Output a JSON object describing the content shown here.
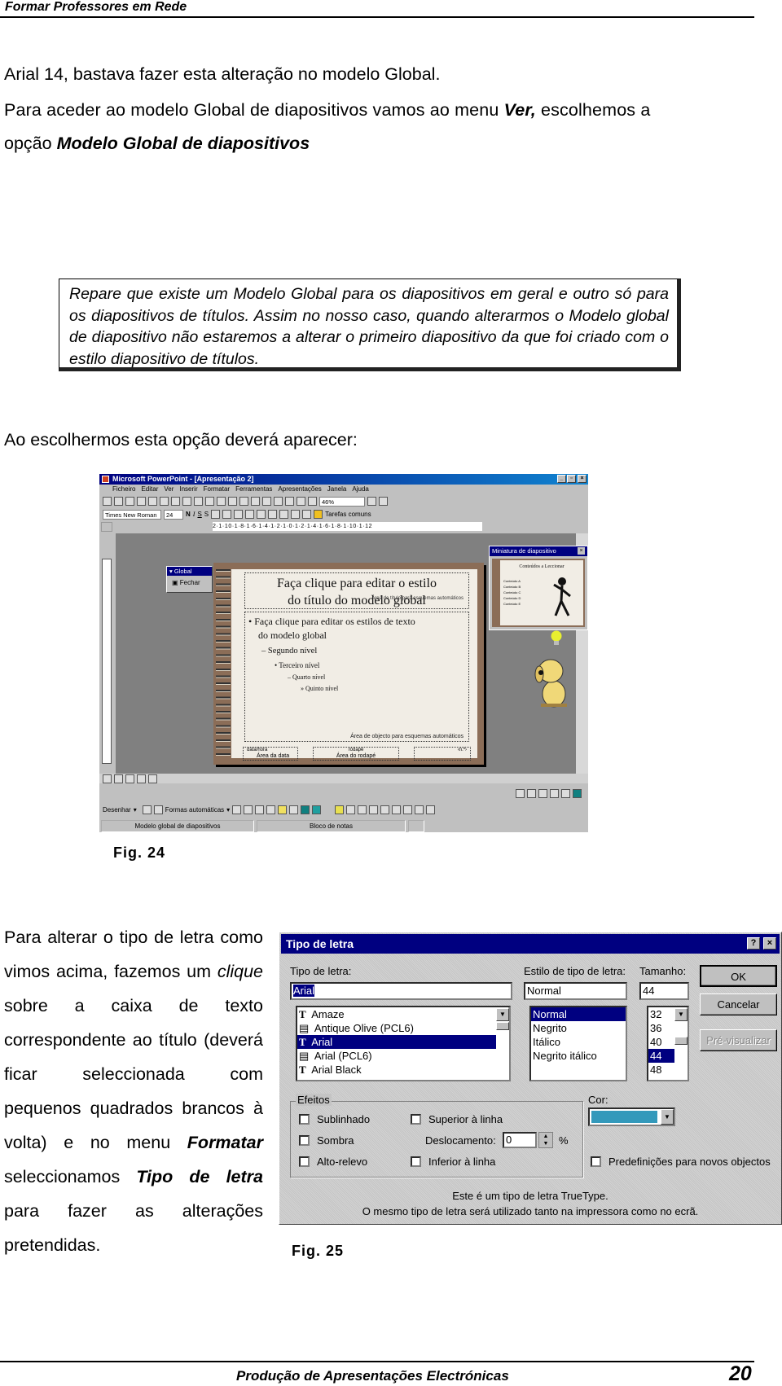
{
  "header": {
    "title": "Formar  Professores em Rede"
  },
  "intro": {
    "line1": "Arial 14, bastava fazer esta alteração no modelo Global.",
    "line2a": "Para aceder ao modelo Global de diapositivos vamos ao menu ",
    "line2b": "Ver,",
    "line2c": " escolhemos a",
    "line3a": "opção ",
    "line3b": "Modelo Global de diapositivos"
  },
  "note": "Repare que existe um Modelo Global para os diapositivos em geral e outro só para os diapositivos de títulos. Assim no nosso caso, quando alterarmos o Modelo global de diapositivo não estaremos a alterar o primeiro diapositivo da que foi criado com o estilo diapositivo de títulos.",
  "lead": "Ao escolhermos esta opção deverá aparecer:",
  "fig24": "Fig. 24",
  "fig25": "Fig. 25",
  "paragraph": {
    "a": "Para alterar o tipo de letra como vimos acima, fazemos um ",
    "b": "clique",
    "c": " sobre a caixa de texto correspondente ao título (deverá ficar seleccionada com pequenos quadrados brancos à volta) e no menu ",
    "d": "Formatar",
    "e": " seleccionamos ",
    "f": "Tipo de letra",
    "g": " para fazer as alterações pretendidas."
  },
  "powerpoint": {
    "title": "Microsoft PowerPoint - [Apresentação 2]",
    "menu": [
      "Ficheiro",
      "Editar",
      "Ver",
      "Inserir",
      "Formatar",
      "Ferramentas",
      "Apresentações",
      "Janela",
      "Ajuda"
    ],
    "zoom": "46%",
    "font": "Times New Roman",
    "size": "24",
    "bold": "N",
    "italic": "I",
    "underline": "S",
    "shadow": "S",
    "tasks": "Tarefas comuns",
    "ruler": "2·1·10·1·8·1·6·1·4·1·2·1·0·1·2·1·4·1·6·1·8·1·10·1·12",
    "global_toolbar": {
      "title": "Global",
      "close": "Fechar"
    },
    "slide": {
      "title": [
        "Faça clique para editar o estilo",
        "do título do modelo global"
      ],
      "title_overlay": "Área de título para esquemas automáticos",
      "levels": [
        "Faça clique para editar os estilos de texto",
        "do modelo global",
        "Segundo nível",
        "Terceiro nível",
        "Quarto nível",
        "Quinto nível"
      ],
      "bullets": [
        "•",
        "–",
        "•",
        "–",
        "»"
      ],
      "object_area": "Área de objecto para esquemas automáticos",
      "date_tag": "data/hora",
      "date_area": "Área da data",
      "footer_tag": "rodapé",
      "footer_area": "Área do rodapé",
      "number_tag": "‹n.º›"
    },
    "miniature": {
      "title": "Miniatura de diapositivo",
      "heading": "Conteúdos a Leccionar",
      "items": [
        "Conteúdo A",
        "Conteúdo B",
        "Conteúdo C",
        "Conteúdo D",
        "Conteúdo E"
      ]
    },
    "drawing": {
      "draw": "Desenhar",
      "autoshapes": "Formas automáticas"
    },
    "status": [
      "Modelo global de diapositivos",
      "Bloco de notas"
    ]
  },
  "font_dialog": {
    "title": "Tipo de letra",
    "font_label": "Tipo de letra:",
    "font_value": "Arial",
    "fonts": [
      "Amaze",
      "Antique Olive (PCL6)",
      "Arial",
      "Arial (PCL6)",
      "Arial Black"
    ],
    "selected_font": "Arial",
    "style_label": "Estilo de tipo de letra:",
    "style_value": "Normal",
    "styles": [
      "Normal",
      "Negrito",
      "Itálico",
      "Negrito itálico"
    ],
    "size_label": "Tamanho:",
    "size_value": "44",
    "sizes": [
      "32",
      "36",
      "40",
      "44",
      "48"
    ],
    "ok": "OK",
    "cancel": "Cancelar",
    "preview": "Pré-visualizar",
    "effects_label": "Efeitos",
    "underline": "Sublinhado",
    "shadow": "Sombra",
    "emboss": "Alto-relevo",
    "superscript": "Superior à linha",
    "offset_label": "Deslocamento:",
    "offset_value": "0",
    "percent": "%",
    "subscript": "Inferior à linha",
    "color_label": "Cor:",
    "color_value": "#3399bb",
    "default": "Predefinições para novos objectos",
    "info1": "Este é um tipo de letra TrueType.",
    "info2": "O mesmo tipo de letra será utilizado tanto na impressora como no ecrã."
  },
  "footer": {
    "title": "Produção de Apresentações Electrónicas",
    "page": "20"
  }
}
